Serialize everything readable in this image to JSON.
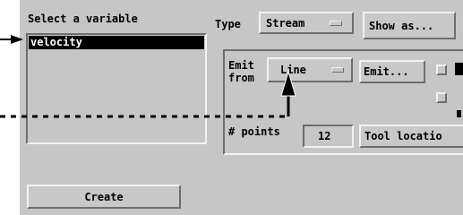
{
  "variables": {
    "heading": "Select a variable",
    "items": [
      "velocity"
    ],
    "selected_index": 0
  },
  "type_control": {
    "label": "Type",
    "value": "Stream"
  },
  "show_as_button": {
    "label": "Show as..."
  },
  "emit_group": {
    "label_line1": "Emit",
    "label_line2": "from",
    "emit_from_value": "Line",
    "emit_button_label": "Emit...",
    "points_label": "# points",
    "points_value": "12",
    "tool_location_label": "Tool locatio"
  },
  "create_button": {
    "label": "Create"
  },
  "colors": {
    "panel_bg": "#c6c6c6",
    "selection_bg": "#000000",
    "selection_text": "#ffffff"
  }
}
